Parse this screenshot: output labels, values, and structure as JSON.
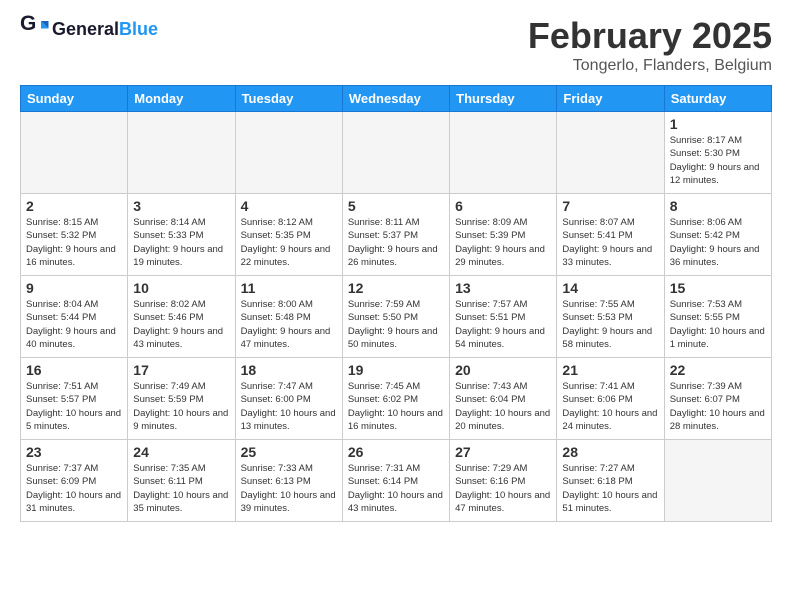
{
  "header": {
    "logo_line1": "General",
    "logo_line2": "Blue",
    "month_year": "February 2025",
    "location": "Tongerlo, Flanders, Belgium"
  },
  "weekdays": [
    "Sunday",
    "Monday",
    "Tuesday",
    "Wednesday",
    "Thursday",
    "Friday",
    "Saturday"
  ],
  "weeks": [
    [
      {
        "day": "",
        "info": "",
        "empty": true
      },
      {
        "day": "",
        "info": "",
        "empty": true
      },
      {
        "day": "",
        "info": "",
        "empty": true
      },
      {
        "day": "",
        "info": "",
        "empty": true
      },
      {
        "day": "",
        "info": "",
        "empty": true
      },
      {
        "day": "",
        "info": "",
        "empty": true
      },
      {
        "day": "1",
        "info": "Sunrise: 8:17 AM\nSunset: 5:30 PM\nDaylight: 9 hours and 12 minutes."
      }
    ],
    [
      {
        "day": "2",
        "info": "Sunrise: 8:15 AM\nSunset: 5:32 PM\nDaylight: 9 hours and 16 minutes."
      },
      {
        "day": "3",
        "info": "Sunrise: 8:14 AM\nSunset: 5:33 PM\nDaylight: 9 hours and 19 minutes."
      },
      {
        "day": "4",
        "info": "Sunrise: 8:12 AM\nSunset: 5:35 PM\nDaylight: 9 hours and 22 minutes."
      },
      {
        "day": "5",
        "info": "Sunrise: 8:11 AM\nSunset: 5:37 PM\nDaylight: 9 hours and 26 minutes."
      },
      {
        "day": "6",
        "info": "Sunrise: 8:09 AM\nSunset: 5:39 PM\nDaylight: 9 hours and 29 minutes."
      },
      {
        "day": "7",
        "info": "Sunrise: 8:07 AM\nSunset: 5:41 PM\nDaylight: 9 hours and 33 minutes."
      },
      {
        "day": "8",
        "info": "Sunrise: 8:06 AM\nSunset: 5:42 PM\nDaylight: 9 hours and 36 minutes."
      }
    ],
    [
      {
        "day": "9",
        "info": "Sunrise: 8:04 AM\nSunset: 5:44 PM\nDaylight: 9 hours and 40 minutes."
      },
      {
        "day": "10",
        "info": "Sunrise: 8:02 AM\nSunset: 5:46 PM\nDaylight: 9 hours and 43 minutes."
      },
      {
        "day": "11",
        "info": "Sunrise: 8:00 AM\nSunset: 5:48 PM\nDaylight: 9 hours and 47 minutes."
      },
      {
        "day": "12",
        "info": "Sunrise: 7:59 AM\nSunset: 5:50 PM\nDaylight: 9 hours and 50 minutes."
      },
      {
        "day": "13",
        "info": "Sunrise: 7:57 AM\nSunset: 5:51 PM\nDaylight: 9 hours and 54 minutes."
      },
      {
        "day": "14",
        "info": "Sunrise: 7:55 AM\nSunset: 5:53 PM\nDaylight: 9 hours and 58 minutes."
      },
      {
        "day": "15",
        "info": "Sunrise: 7:53 AM\nSunset: 5:55 PM\nDaylight: 10 hours and 1 minute."
      }
    ],
    [
      {
        "day": "16",
        "info": "Sunrise: 7:51 AM\nSunset: 5:57 PM\nDaylight: 10 hours and 5 minutes."
      },
      {
        "day": "17",
        "info": "Sunrise: 7:49 AM\nSunset: 5:59 PM\nDaylight: 10 hours and 9 minutes."
      },
      {
        "day": "18",
        "info": "Sunrise: 7:47 AM\nSunset: 6:00 PM\nDaylight: 10 hours and 13 minutes."
      },
      {
        "day": "19",
        "info": "Sunrise: 7:45 AM\nSunset: 6:02 PM\nDaylight: 10 hours and 16 minutes."
      },
      {
        "day": "20",
        "info": "Sunrise: 7:43 AM\nSunset: 6:04 PM\nDaylight: 10 hours and 20 minutes."
      },
      {
        "day": "21",
        "info": "Sunrise: 7:41 AM\nSunset: 6:06 PM\nDaylight: 10 hours and 24 minutes."
      },
      {
        "day": "22",
        "info": "Sunrise: 7:39 AM\nSunset: 6:07 PM\nDaylight: 10 hours and 28 minutes."
      }
    ],
    [
      {
        "day": "23",
        "info": "Sunrise: 7:37 AM\nSunset: 6:09 PM\nDaylight: 10 hours and 31 minutes."
      },
      {
        "day": "24",
        "info": "Sunrise: 7:35 AM\nSunset: 6:11 PM\nDaylight: 10 hours and 35 minutes."
      },
      {
        "day": "25",
        "info": "Sunrise: 7:33 AM\nSunset: 6:13 PM\nDaylight: 10 hours and 39 minutes."
      },
      {
        "day": "26",
        "info": "Sunrise: 7:31 AM\nSunset: 6:14 PM\nDaylight: 10 hours and 43 minutes."
      },
      {
        "day": "27",
        "info": "Sunrise: 7:29 AM\nSunset: 6:16 PM\nDaylight: 10 hours and 47 minutes."
      },
      {
        "day": "28",
        "info": "Sunrise: 7:27 AM\nSunset: 6:18 PM\nDaylight: 10 hours and 51 minutes."
      },
      {
        "day": "",
        "info": "",
        "empty": true
      }
    ]
  ]
}
